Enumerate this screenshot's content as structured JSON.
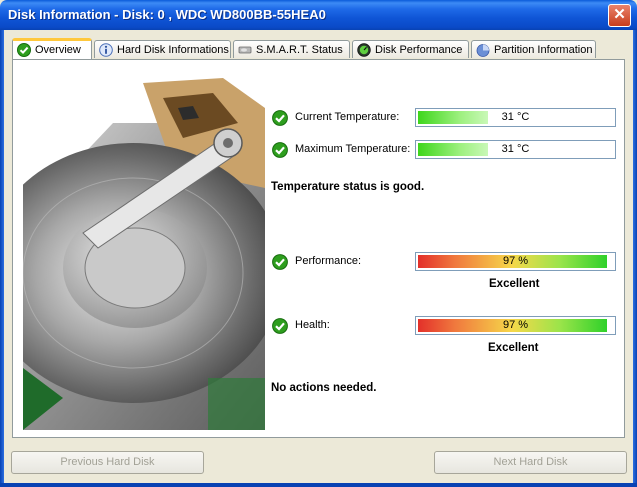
{
  "window": {
    "title": "Disk Information - Disk: 0 , WDC WD800BB-55HEA0",
    "close_symbol": "✕"
  },
  "tabs": [
    {
      "label": "Overview",
      "icon": "green-check-icon",
      "active": true
    },
    {
      "label": "Hard Disk Informations",
      "icon": "info-icon",
      "active": false
    },
    {
      "label": "S.M.A.R.T. Status",
      "icon": "disk-icon",
      "active": false
    },
    {
      "label": "Disk Performance",
      "icon": "gauge-icon",
      "active": false
    },
    {
      "label": "Partition Information",
      "icon": "pie-icon",
      "active": false
    }
  ],
  "overview": {
    "current_temperature": {
      "label": "Current Temperature:",
      "value": "31 °C",
      "level": 0.36
    },
    "maximum_temperature": {
      "label": "Maximum Temperature:",
      "value": "31 °C",
      "level": 0.36
    },
    "temperature_status": "Temperature status is good.",
    "performance": {
      "label": "Performance:",
      "value": "97 %",
      "level": 0.97,
      "rating": "Excellent"
    },
    "health": {
      "label": "Health:",
      "value": "97 %",
      "level": 0.97,
      "rating": "Excellent"
    },
    "actions_status": "No actions needed."
  },
  "buttons": {
    "previous": "Previous Hard Disk",
    "next": "Next Hard Disk"
  },
  "colors": {
    "title_bar": "#0a4ac8",
    "panel_bg": "#ffffff",
    "ok_green": "#2e9e1e",
    "active_tab_accent": "#ffc83c"
  }
}
